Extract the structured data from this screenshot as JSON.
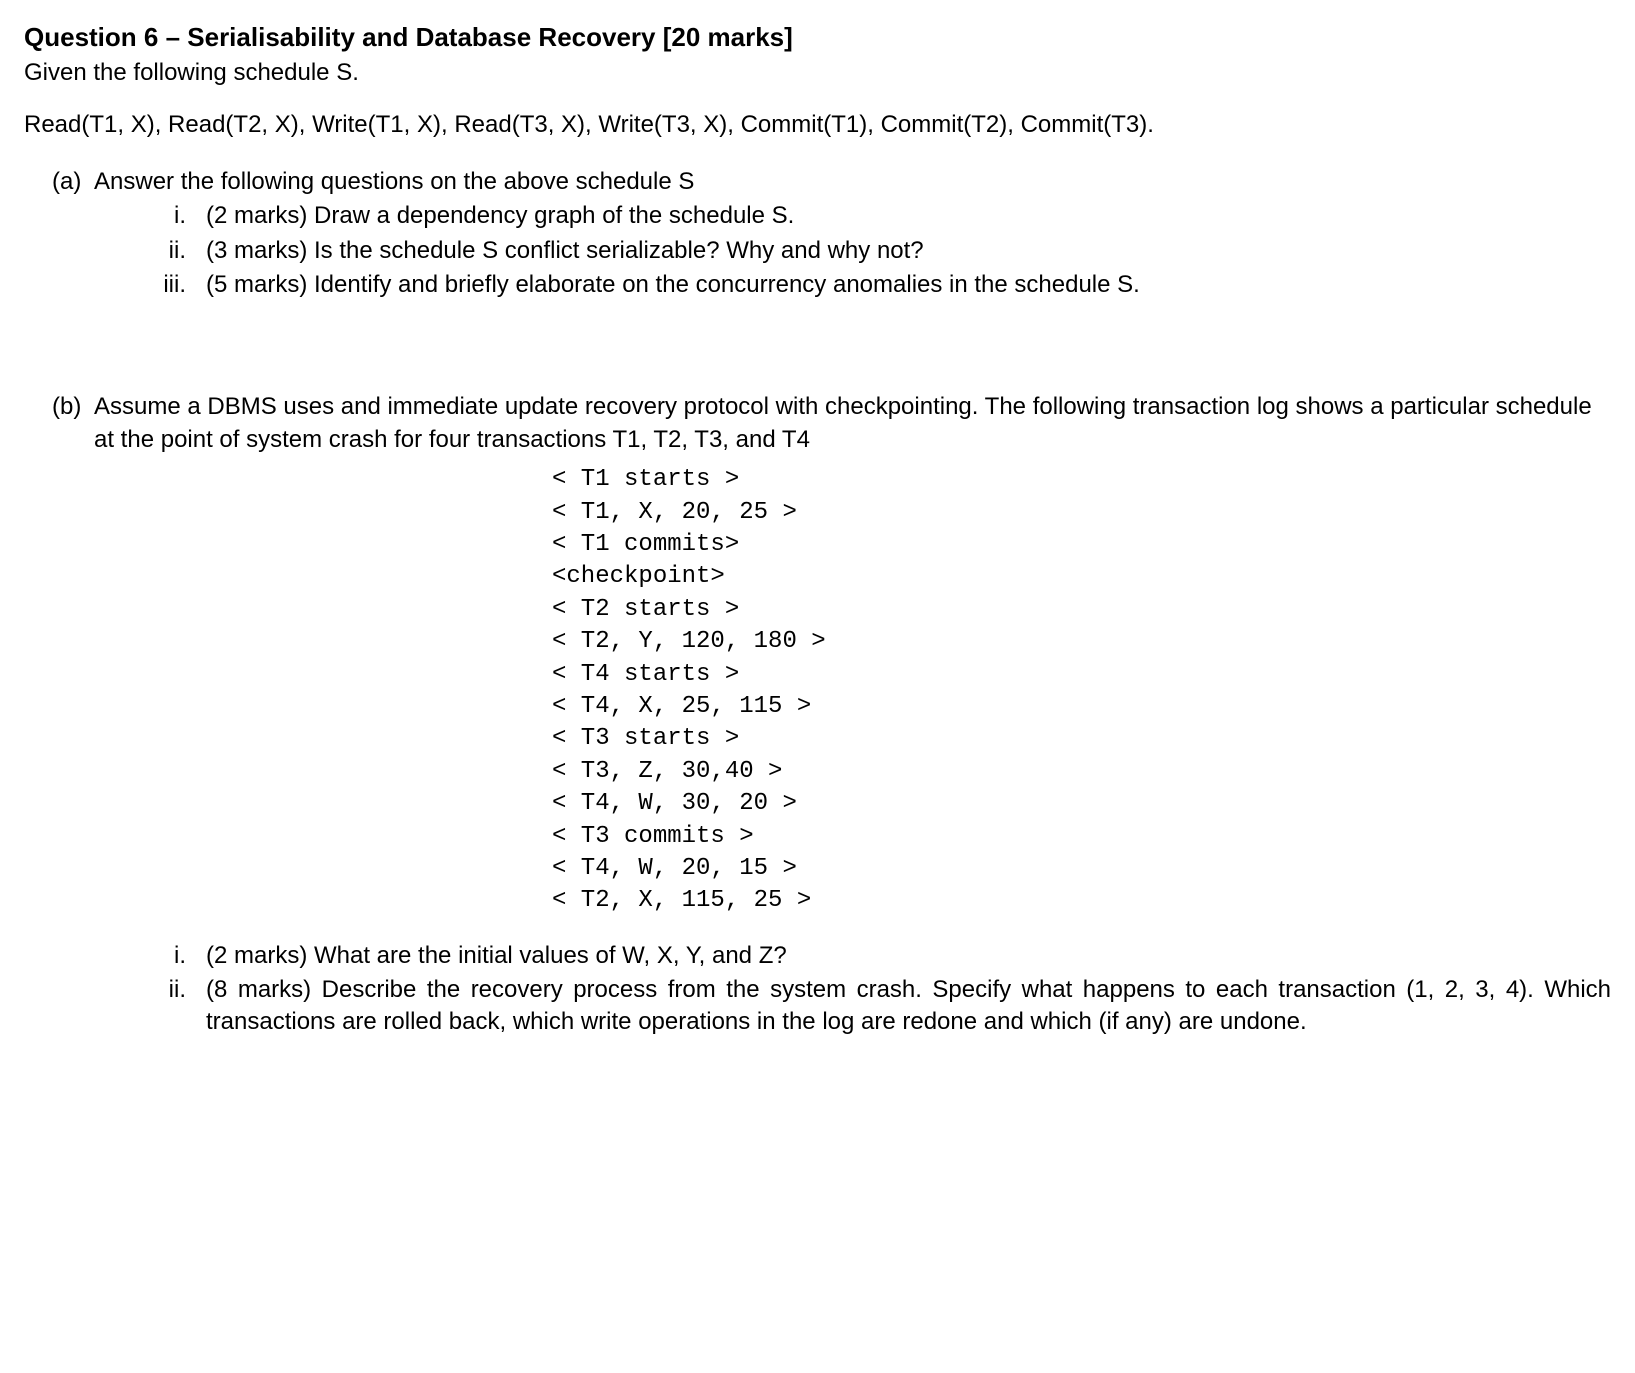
{
  "title": "Question 6 – Serialisability and Database Recovery [20 marks]",
  "intro": "Given the following schedule S.",
  "schedule": "Read(T1, X), Read(T2, X), Write(T1, X), Read(T3, X), Write(T3, X), Commit(T1), Commit(T2), Commit(T3).",
  "part_a": {
    "label": "(a)",
    "text": "Answer the following questions on the above schedule S",
    "items": [
      {
        "label": "i.",
        "text": "(2 marks) Draw a dependency graph of the schedule S."
      },
      {
        "label": "ii.",
        "text": "(3 marks) Is the schedule S conflict serializable? Why and why not?"
      },
      {
        "label": "iii.",
        "text": "(5 marks) Identify and briefly elaborate on the concurrency anomalies in the schedule S."
      }
    ]
  },
  "part_b": {
    "label": "(b)",
    "text": "Assume a DBMS uses and immediate update recovery protocol with checkpointing. The following transaction log shows a particular schedule at the point of system crash for four transactions T1, T2, T3, and T4",
    "log": "< T1 starts >\n< T1, X, 20, 25 >\n< T1 commits>\n<checkpoint>\n< T2 starts >\n< T2, Y, 120, 180 >\n< T4 starts >\n< T4, X, 25, 115 >\n< T3 starts >\n< T3, Z, 30,40 >\n< T4, W, 30, 20 >\n< T3 commits >\n< T4, W, 20, 15 >\n< T2, X, 115, 25 >",
    "items": [
      {
        "label": "i.",
        "text": "(2 marks) What are the initial values of W, X, Y, and Z?"
      },
      {
        "label": "ii.",
        "text": "(8 marks) Describe the recovery process from the system crash. Specify what happens to each transaction (1, 2, 3, 4). Which transactions are rolled back, which write operations in the log are redone and which (if any) are undone."
      }
    ]
  }
}
